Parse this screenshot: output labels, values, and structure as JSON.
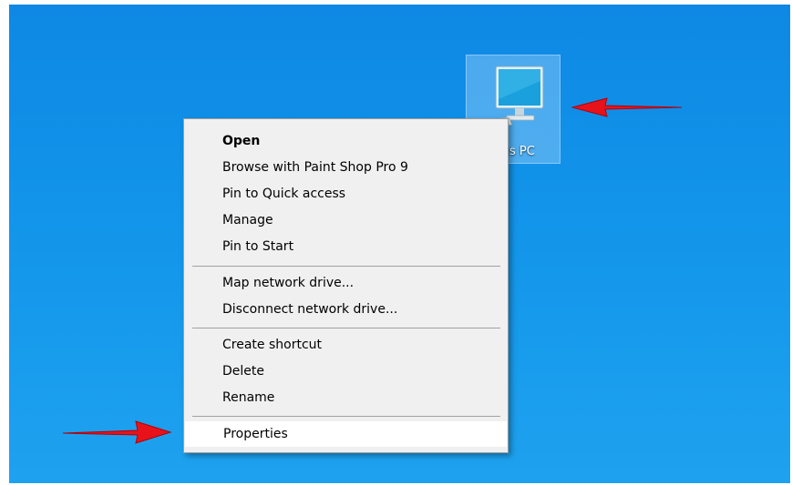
{
  "desktop": {
    "background_color": "#1391e8",
    "icon": {
      "name": "this-pc",
      "label": "This PC",
      "icon_name": "computer-monitor-icon",
      "selected": true
    }
  },
  "annotations": {
    "arrow_color": "#e8121a",
    "arrows": [
      "pointing-at-this-pc-icon",
      "pointing-at-properties"
    ]
  },
  "context_menu": {
    "groups": [
      [
        {
          "label": "Open",
          "bold": true
        },
        {
          "label": "Browse with Paint Shop Pro 9"
        },
        {
          "label": "Pin to Quick access"
        },
        {
          "label": "Manage"
        },
        {
          "label": "Pin to Start"
        }
      ],
      [
        {
          "label": "Map network drive..."
        },
        {
          "label": "Disconnect network drive..."
        }
      ],
      [
        {
          "label": "Create shortcut"
        },
        {
          "label": "Delete"
        },
        {
          "label": "Rename"
        }
      ],
      [
        {
          "label": "Properties",
          "highlighted": true
        }
      ]
    ]
  }
}
